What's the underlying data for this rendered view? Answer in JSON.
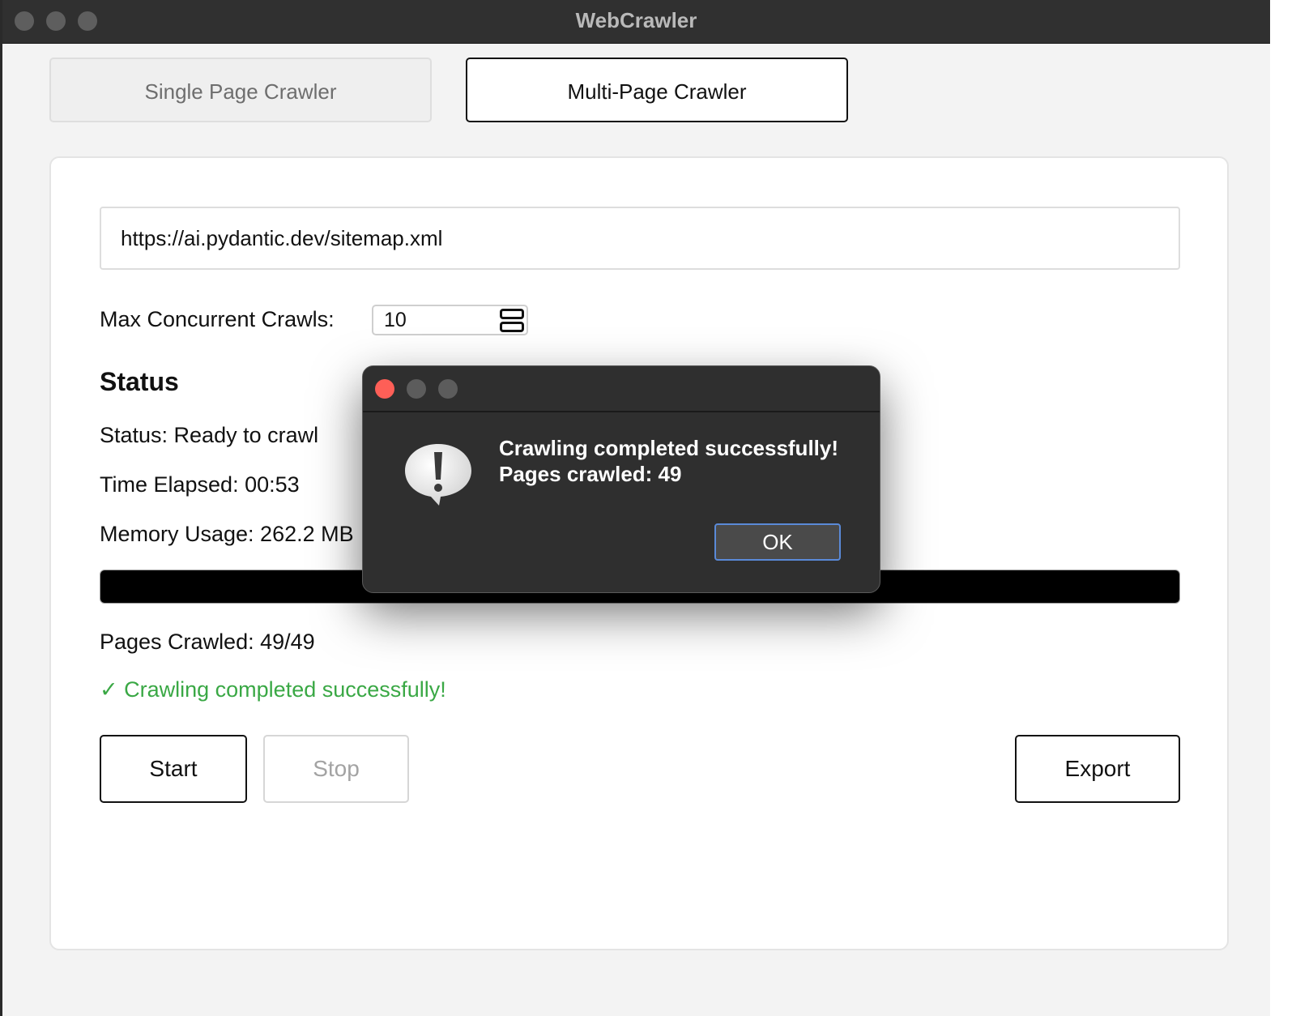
{
  "window": {
    "title": "WebCrawler"
  },
  "tabs": [
    {
      "label": "Single Page Crawler",
      "active": false
    },
    {
      "label": "Multi-Page Crawler",
      "active": true
    }
  ],
  "form": {
    "url_value": "https://ai.pydantic.dev/sitemap.xml",
    "max_concurrent_label": "Max Concurrent Crawls:",
    "max_concurrent_value": "10"
  },
  "status": {
    "heading": "Status",
    "status_text": "Status: Ready to crawl",
    "time_elapsed": "Time Elapsed: 00:53",
    "memory_usage": "Memory Usage: 262.2 MB",
    "progress_percent": 100,
    "pages_crawled": "Pages Crawled: 49/49",
    "success_message": "✓ Crawling completed successfully!",
    "success_color": "#3aa845"
  },
  "buttons": {
    "start": "Start",
    "stop": "Stop",
    "export": "Export"
  },
  "dialog": {
    "message_line1": "Crawling completed successfully!",
    "message_line2": "Pages crawled: 49",
    "ok_label": "OK",
    "icon": "alert-caution-icon"
  }
}
